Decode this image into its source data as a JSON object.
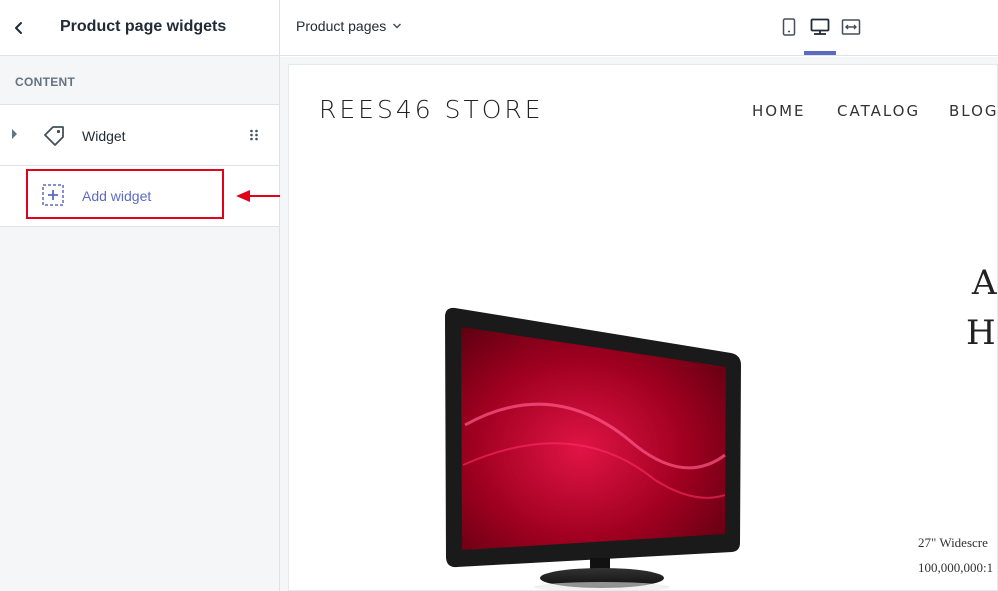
{
  "sidebar": {
    "title": "Product page widgets",
    "section_label": "CONTENT",
    "items": [
      {
        "label": "Widget",
        "icon": "tag-icon"
      }
    ],
    "add_label": "Add widget"
  },
  "topbar": {
    "page_select": "Product pages",
    "devices": [
      "mobile-icon",
      "desktop-icon",
      "fullscreen-icon"
    ],
    "active_device": "desktop-icon"
  },
  "preview": {
    "store_name": "REES46 STORE",
    "nav": [
      "HOME",
      "CATALOG",
      "BLOG"
    ],
    "product_title_line1": "A",
    "product_title_line2": "HI",
    "desc_line1": "27\" Widescre",
    "desc_line2": "100,000,000:1"
  },
  "colors": {
    "accent": "#5c6ac4",
    "annotation": "#e3001b"
  }
}
